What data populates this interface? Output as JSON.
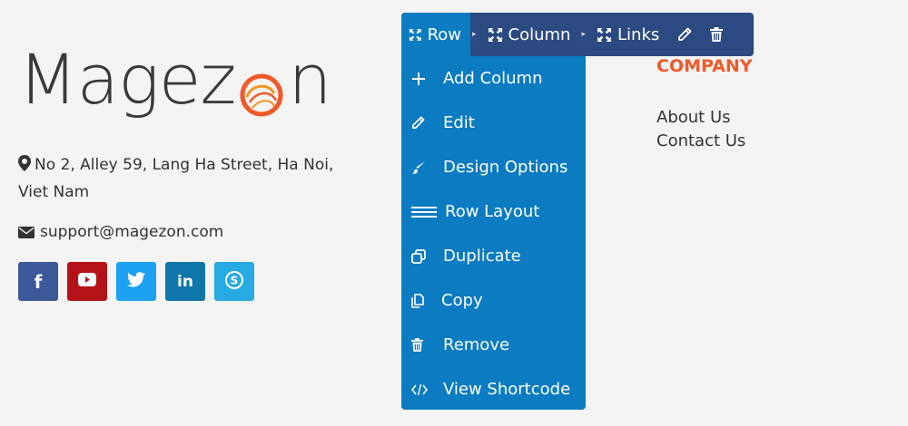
{
  "logo": {
    "text_before": "Magez",
    "text_after": "n",
    "accent_color": "#f1592a"
  },
  "contact": {
    "address_line1": "No 2, Alley 59, Lang Ha Street, Ha Noi,",
    "address_line2": "Viet Nam",
    "email": "support@magezon.com"
  },
  "socials": [
    {
      "name": "facebook",
      "glyph": "f",
      "color": "#3b5998"
    },
    {
      "name": "youtube",
      "glyph": "▶",
      "color": "#b31217"
    },
    {
      "name": "twitter",
      "glyph": "t",
      "color": "#1da1f2"
    },
    {
      "name": "linkedin",
      "glyph": "in",
      "color": "#0e76a8"
    },
    {
      "name": "skype",
      "glyph": "S",
      "color": "#27aae1"
    }
  ],
  "company": {
    "title": "COMPANY",
    "links": [
      "About Us",
      "Contact Us"
    ]
  },
  "toolbar": {
    "row_label": "Row",
    "column_label": "Column",
    "links_label": "Links",
    "separator": "▸"
  },
  "menu": {
    "items": [
      {
        "label": "Add Column",
        "icon": "plus-icon"
      },
      {
        "label": "Edit",
        "icon": "pencil-icon"
      },
      {
        "label": "Design Options",
        "icon": "brush-icon"
      },
      {
        "label": "Row Layout",
        "icon": "layout-lines-icon"
      },
      {
        "label": "Duplicate",
        "icon": "duplicate-icon"
      },
      {
        "label": "Copy",
        "icon": "copy-icon"
      },
      {
        "label": "Remove",
        "icon": "trash-icon"
      },
      {
        "label": "View Shortcode",
        "icon": "code-icon"
      }
    ]
  },
  "colors": {
    "toolbar_bg": "#2c4a82",
    "menu_bg": "#0b7bc2",
    "page_bg": "#f4f4f4"
  }
}
